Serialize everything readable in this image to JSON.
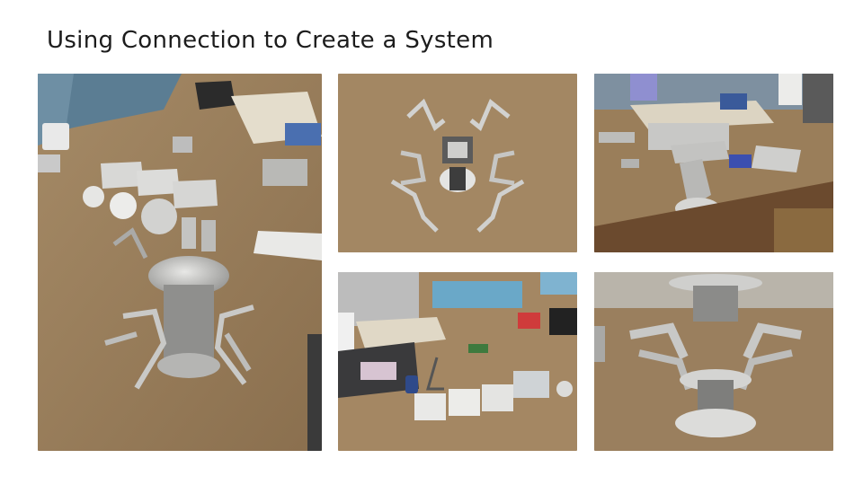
{
  "slide": {
    "title": "Using Connection to Create a System"
  },
  "photos": [
    {
      "id": "workbench-assembly-photo"
    },
    {
      "id": "bent-strip-closeup-photo"
    },
    {
      "id": "cluttered-workbench-photo"
    },
    {
      "id": "tools-and-plates-photo"
    },
    {
      "id": "stacked-assembly-closeup-photo"
    }
  ]
}
